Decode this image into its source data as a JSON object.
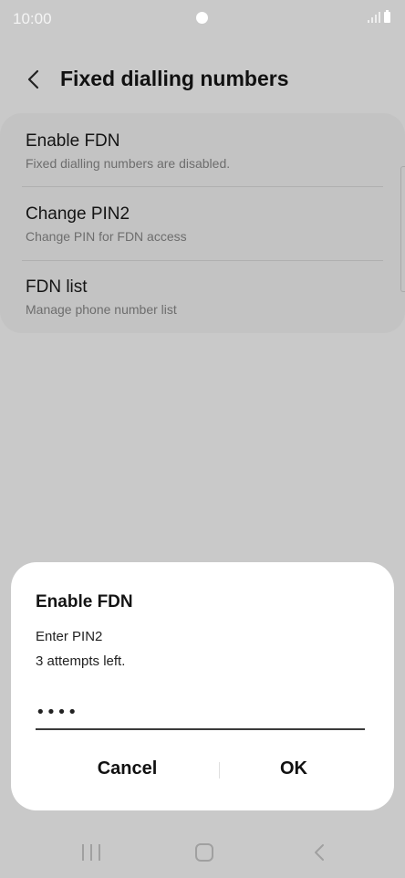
{
  "status_bar": {
    "time": "10:00"
  },
  "header": {
    "title": "Fixed dialling numbers"
  },
  "settings": {
    "items": [
      {
        "title": "Enable FDN",
        "subtitle": "Fixed dialling numbers are disabled."
      },
      {
        "title": "Change PIN2",
        "subtitle": "Change PIN for FDN access"
      },
      {
        "title": "FDN list",
        "subtitle": "Manage phone number list"
      }
    ]
  },
  "dialog": {
    "title": "Enable FDN",
    "message_line1": "Enter PIN2",
    "message_line2": "3 attempts left.",
    "pin_value": "••••",
    "cancel_label": "Cancel",
    "ok_label": "OK"
  },
  "colors": {
    "dim_background": "#c9c9c9",
    "dialog_background": "#ffffff"
  }
}
